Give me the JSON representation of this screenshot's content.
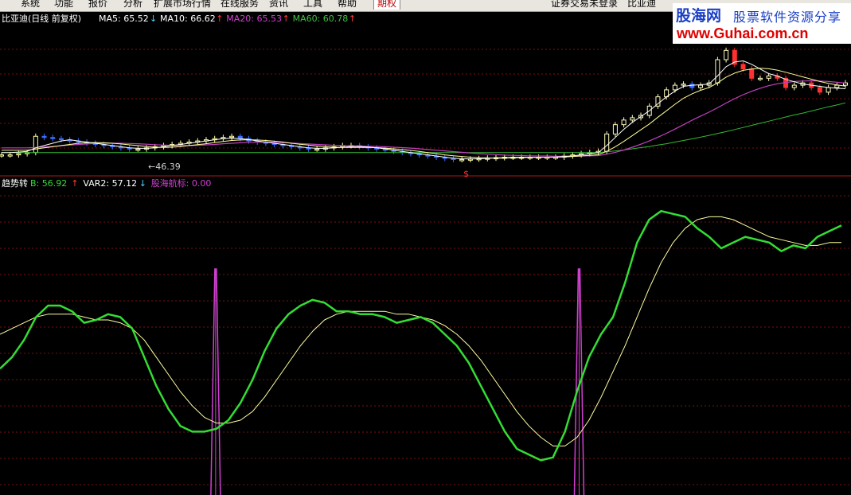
{
  "menu": {
    "items": [
      "系统",
      "功能",
      "报价",
      "分析",
      "扩展市场行情",
      "在线服务",
      "资讯",
      "工具",
      "帮助"
    ],
    "active_tab": "期权",
    "right_status": "证券交易未登录",
    "right_symbol": "比亚迪"
  },
  "price_panel": {
    "title": "比亚迪(日线 前复权)",
    "ma": [
      {
        "label": "MA5: 65.52",
        "arrow": "↓",
        "color": "#ffffff",
        "arrow_color": "#4fd0ff"
      },
      {
        "label": "MA10: 66.62",
        "arrow": "↑",
        "color": "#ffffff",
        "arrow_color": "#ff3b3b"
      },
      {
        "label": "MA20: 65.53",
        "arrow": "↑",
        "color": "#d040d0",
        "arrow_color": "#ff3b3b"
      },
      {
        "label": "MA60: 60.78",
        "arrow": "↑",
        "color": "#40c040",
        "arrow_color": "#ff3b3b"
      }
    ],
    "low_annotation": "←46.39",
    "marker_symbol": "$"
  },
  "indicator_panel": {
    "name": "趋势转",
    "values": [
      {
        "label": "B: 56.92",
        "arrow": "↑",
        "color": "#33dd33",
        "arrow_color": "#ff3b3b"
      },
      {
        "label": "VAR2: 57.12",
        "arrow": "↓",
        "color": "#ffffff",
        "arrow_color": "#4fd0ff"
      },
      {
        "label": "股海航标: 0.00",
        "arrow": "",
        "color": "#d040d0",
        "arrow_color": "#d040d0"
      }
    ]
  },
  "watermark": {
    "site_name": "股海网",
    "slogan": "股票软件资源分享",
    "url": "www.Guhai.com.cn"
  },
  "chart_data": {
    "type": "line",
    "x_count": 100,
    "price_close": [
      37,
      37,
      37.5,
      38,
      45,
      44.5,
      44,
      43.5,
      43,
      42.5,
      42,
      41.5,
      41,
      40.5,
      40,
      39.5,
      39.5,
      40,
      40.5,
      41,
      41.5,
      42,
      42.5,
      43,
      43.5,
      44,
      44.5,
      45,
      44,
      43,
      42.5,
      42,
      41.5,
      41,
      40.5,
      40,
      39.5,
      39.5,
      40,
      40.5,
      41,
      41,
      40.5,
      40,
      39.5,
      39,
      38.5,
      38,
      37.5,
      37,
      36.5,
      36,
      35.5,
      35,
      35,
      35.2,
      35.4,
      35.6,
      35.8,
      36,
      36,
      36,
      36,
      36,
      36,
      36,
      36.5,
      37,
      37.5,
      38,
      38.5,
      46,
      50,
      52,
      53,
      54,
      58,
      62,
      65,
      67,
      67.5,
      66,
      67,
      68,
      78,
      82,
      76,
      74,
      70,
      70,
      71,
      70,
      66,
      67,
      68,
      66,
      64,
      66,
      67,
      68
    ],
    "ma5": [
      38,
      38,
      38.2,
      38.5,
      40,
      41,
      42,
      43,
      43.5,
      43,
      42.5,
      42,
      41.5,
      41,
      40.5,
      40,
      39.8,
      39.8,
      40,
      40.5,
      41,
      41.5,
      42,
      42.5,
      43,
      43.5,
      44,
      44.2,
      44,
      43.6,
      43,
      42.5,
      42,
      41.5,
      41,
      40.5,
      40,
      39.8,
      39.8,
      40,
      40.3,
      40.6,
      40.6,
      40.4,
      40,
      39.6,
      39,
      38.5,
      38,
      37.5,
      37,
      36.5,
      36,
      35.6,
      35.3,
      35.2,
      35.3,
      35.5,
      35.7,
      35.8,
      35.9,
      36,
      36,
      36,
      36,
      36.1,
      36.3,
      36.6,
      37,
      37.5,
      38,
      41,
      44.5,
      48,
      51,
      53.5,
      56,
      59,
      62,
      64.5,
      66.5,
      67,
      67.2,
      67.5,
      71,
      75,
      77,
      77.5,
      76,
      74,
      72,
      71,
      69.5,
      68.5,
      67.5,
      67,
      66.5,
      66,
      65.7,
      65.5
    ],
    "ma10": [
      39,
      39,
      39,
      39,
      39.5,
      40,
      40.5,
      41,
      41.5,
      42,
      42.2,
      42.3,
      42.2,
      42,
      41.7,
      41.3,
      41,
      40.6,
      40.3,
      40.2,
      40.3,
      40.6,
      41,
      41.4,
      41.8,
      42.3,
      42.8,
      43.2,
      43.4,
      43.5,
      43.4,
      43.2,
      42.9,
      42.5,
      42,
      41.6,
      41.2,
      40.8,
      40.5,
      40.3,
      40.2,
      40.2,
      40.2,
      40.2,
      40.1,
      39.9,
      39.6,
      39.3,
      38.9,
      38.5,
      38,
      37.5,
      37,
      36.6,
      36.3,
      36,
      35.8,
      35.7,
      35.6,
      35.6,
      35.7,
      35.8,
      35.9,
      35.9,
      36,
      36,
      36.1,
      36.3,
      36.5,
      36.8,
      37.1,
      38.5,
      40.5,
      42.8,
      45.3,
      47.8,
      50.3,
      53.2,
      56,
      58.8,
      61.4,
      63.3,
      64.8,
      66,
      68,
      70.5,
      72.2,
      73.4,
      74,
      74.3,
      74.1,
      73.5,
      72.6,
      71.6,
      70.6,
      69.6,
      68.6,
      67.8,
      67.1,
      66.6
    ],
    "ma20": [
      40,
      40,
      40,
      40,
      40.2,
      40.4,
      40.6,
      40.9,
      41.2,
      41.5,
      41.7,
      41.9,
      42,
      42,
      42,
      41.9,
      41.8,
      41.6,
      41.4,
      41.2,
      41.1,
      41,
      41,
      41.1,
      41.3,
      41.5,
      41.8,
      42,
      42.2,
      42.4,
      42.5,
      42.5,
      42.4,
      42.3,
      42.1,
      41.9,
      41.7,
      41.5,
      41.3,
      41.1,
      41,
      40.9,
      40.8,
      40.7,
      40.6,
      40.5,
      40.3,
      40.1,
      39.9,
      39.6,
      39.3,
      39,
      38.7,
      38.4,
      38.1,
      37.8,
      37.5,
      37.3,
      37.1,
      36.9,
      36.8,
      36.7,
      36.6,
      36.5,
      36.5,
      36.4,
      36.4,
      36.4,
      36.5,
      36.6,
      36.7,
      37.3,
      38.1,
      39.1,
      40.3,
      41.6,
      43,
      44.6,
      46.3,
      48.1,
      50,
      51.9,
      53.7,
      55.4,
      57.3,
      59.3,
      61.2,
      62.9,
      64.4,
      65.7,
      66.8,
      67.6,
      68.2,
      68.6,
      68.8,
      68.9,
      68.8,
      68.6,
      68.3,
      67.9
    ],
    "ma60": [
      38,
      38,
      38,
      38,
      38,
      38,
      38,
      38,
      38,
      38,
      38,
      38,
      38,
      38,
      38,
      38,
      38,
      38,
      38,
      38,
      38,
      38,
      38,
      38,
      38,
      38,
      38,
      38,
      38,
      38,
      38,
      38,
      38,
      38,
      38,
      38,
      38,
      38,
      38,
      38,
      38,
      38,
      38,
      38,
      38,
      38,
      38,
      38,
      38,
      38,
      38,
      38,
      38,
      38,
      38,
      38,
      38,
      38,
      38,
      38,
      38,
      38,
      38,
      38,
      38,
      38,
      38,
      38,
      38,
      38,
      38,
      38.3,
      38.7,
      39.1,
      39.6,
      40.1,
      40.6,
      41.2,
      41.8,
      42.5,
      43.2,
      43.9,
      44.6,
      45.4,
      46.2,
      47,
      47.9,
      48.8,
      49.7,
      50.6,
      51.5,
      52.4,
      53.3,
      54.2,
      55,
      55.9,
      56.8,
      57.7,
      58.5,
      59.4
    ],
    "indicator_b": [
      38,
      42,
      48,
      56,
      60,
      60,
      58,
      54,
      55,
      57,
      56,
      52,
      42,
      32,
      24,
      18,
      16,
      16,
      17,
      20,
      26,
      34,
      44,
      52,
      57,
      60,
      62,
      61,
      58,
      58,
      57,
      57,
      56,
      54,
      55,
      56,
      54,
      50,
      46,
      40,
      32,
      24,
      16,
      10,
      8,
      6,
      7,
      16,
      30,
      42,
      50,
      56,
      68,
      82,
      90,
      93,
      92,
      91,
      87,
      84,
      80,
      82,
      84,
      83,
      82,
      79,
      81,
      80,
      84,
      86,
      88
    ],
    "indicator_var2": [
      50,
      52,
      54,
      56,
      57,
      57,
      57,
      56,
      55,
      55,
      54,
      52,
      48,
      42,
      36,
      30,
      25,
      21,
      19,
      19,
      20,
      23,
      28,
      34,
      40,
      46,
      51,
      55,
      57,
      58,
      58,
      58,
      58,
      57,
      57,
      56,
      55,
      53,
      50,
      46,
      41,
      35,
      29,
      23,
      18,
      14,
      11,
      11,
      14,
      20,
      28,
      37,
      46,
      56,
      66,
      75,
      82,
      87,
      90,
      91,
      91,
      90,
      88,
      86,
      84,
      83,
      82,
      81,
      81,
      82,
      82
    ],
    "signal_spikes": [
      0.24,
      0.685
    ],
    "price_ylim": [
      30,
      90
    ],
    "indicator_ylim": [
      0,
      100
    ],
    "grid": true,
    "title": "比亚迪(日线 前复权)"
  }
}
